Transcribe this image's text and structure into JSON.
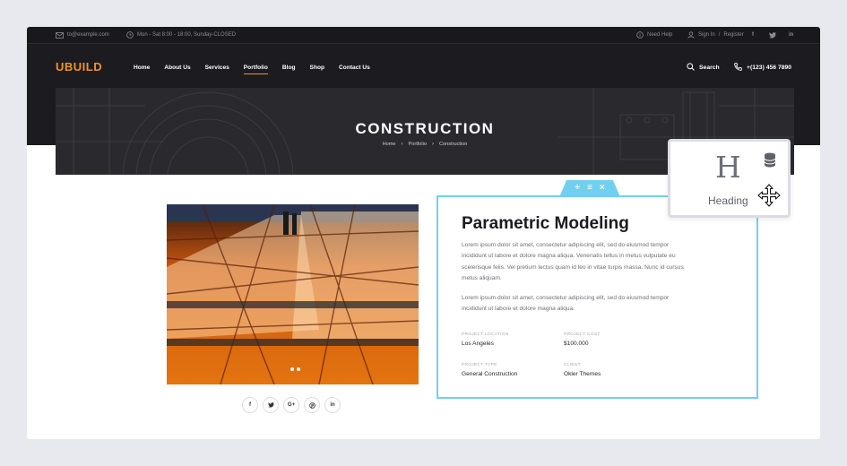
{
  "topbar": {
    "email": "to@example.com",
    "hours": "Mon - Sat 8:00 - 18:00, Sunday-CLOSED",
    "need_help": "Need Help",
    "sign_in": "Sign In",
    "slash": "/",
    "register": "Register",
    "social": [
      "f",
      "t",
      "in"
    ]
  },
  "header": {
    "logo": "UBUILD",
    "nav": [
      "Home",
      "About Us",
      "Services",
      "Portfolio",
      "Blog",
      "Shop",
      "Contact Us"
    ],
    "active_nav": "Portfolio",
    "search": "Search",
    "phone": "+(123) 456 7890"
  },
  "hero": {
    "title": "CONSTRUCTION",
    "breadcrumb": [
      "Home",
      "Portfolio",
      "Construction"
    ]
  },
  "project": {
    "social_share": [
      "f",
      "t",
      "G+",
      "p",
      "in"
    ],
    "title": "Parametric Modeling",
    "paragraph_1": "Lorem ipsum dolor sit amet, consectetur adipiscing elit, sed do eiusmod tempor incididunt ut labore et dolore magna aliqua. Venenatis tellus in metus vulputate eu scelerisque felis. Vel pretium lectus quam id leo in vitae turpis massa. Nunc id cursus metus aliquam.",
    "paragraph_2": "Lorem ipsum dolor sit amet, consectetur adipiscing elit, sed do eiusmod tempor incididunt ut labore et dolore magna aliqua.",
    "details": [
      {
        "label": "PROJECT LOCATION",
        "value": "Los Angeles"
      },
      {
        "label": "PROJECT COST",
        "value": "$100.000"
      },
      {
        "label": "PROJECT TYPE",
        "value": "General Construction"
      },
      {
        "label": "CLIENT",
        "value": "Okler Themes"
      }
    ]
  },
  "editor": {
    "toolbar": [
      "+",
      "≡",
      "×"
    ],
    "widget_label": "Heading",
    "widget_icon": "H"
  },
  "colors": {
    "accent": "#f2922b",
    "selection": "#71d0ef",
    "dark": "#1c1c20"
  }
}
